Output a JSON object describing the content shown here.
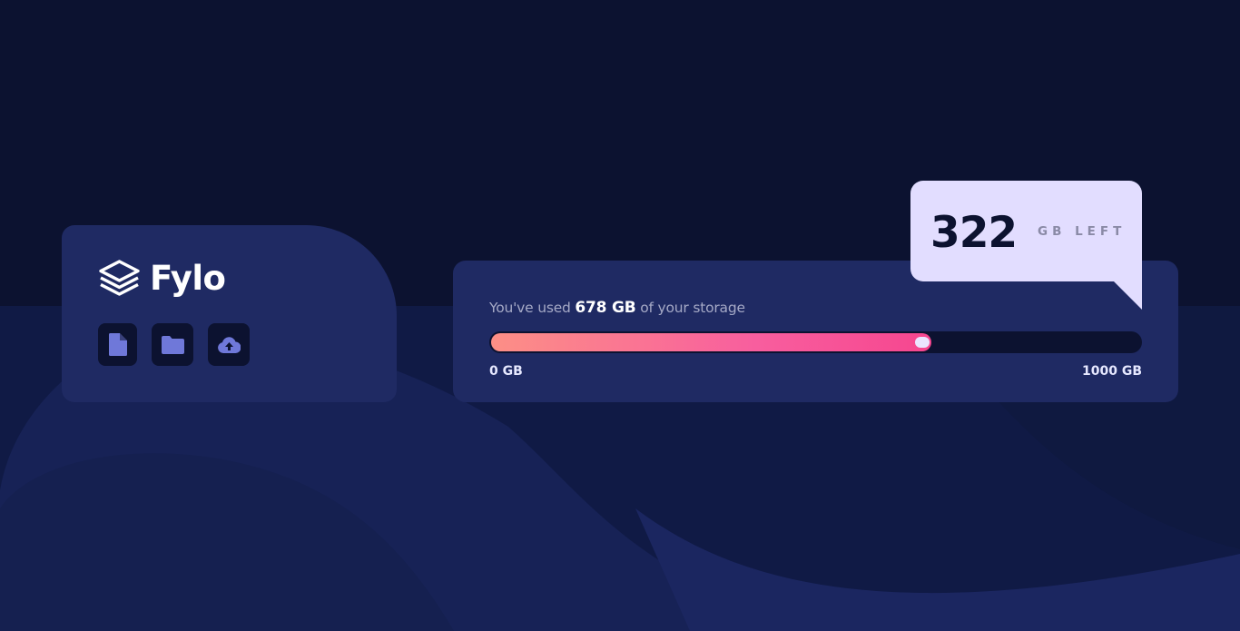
{
  "brand": {
    "name": "Fylo",
    "icon": "stacked-layers-icon"
  },
  "toolbar": [
    {
      "name": "file-button",
      "icon": "file-icon"
    },
    {
      "name": "folder-button",
      "icon": "folder-icon"
    },
    {
      "name": "upload-button",
      "icon": "cloud-upload-icon"
    }
  ],
  "storage": {
    "prefix": "You've used ",
    "used_value": "678 GB",
    "suffix": " of your storage",
    "used_gb": 678,
    "total_gb": 1000,
    "min_label": "0 GB",
    "max_label": "1000 GB"
  },
  "callout": {
    "remaining": "322",
    "label": "GB LEFT"
  },
  "colors": {
    "page_bg": "#0c1230",
    "card_bg": "#1f2a63",
    "callout_bg": "#e2ddff",
    "bar_start": "#fc8f86",
    "bar_end": "#f6468f",
    "icon": "#6f78d9"
  }
}
